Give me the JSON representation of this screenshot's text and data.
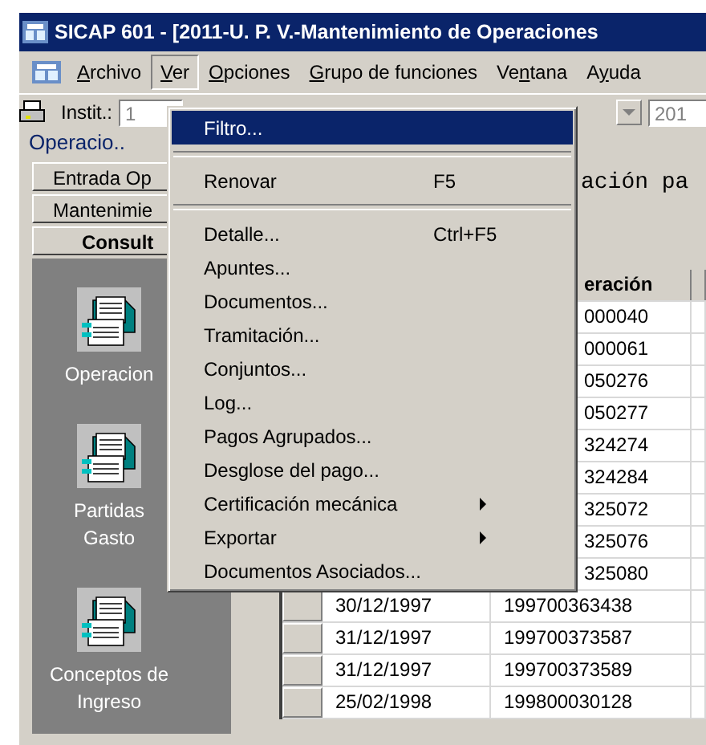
{
  "window": {
    "title": "SICAP 601 - [2011-U. P. V.-Mantenimiento de Operaciones"
  },
  "menubar": [
    {
      "key": "A",
      "post": "rchivo",
      "selected": false
    },
    {
      "key": "V",
      "post": "er",
      "selected": true
    },
    {
      "key": "O",
      "post": "pciones",
      "selected": false
    },
    {
      "key": "G",
      "post": "rupo de funciones",
      "selected": false
    },
    {
      "pre": "Ve",
      "key": "n",
      "post": "tana",
      "selected": false
    },
    {
      "pre": "A",
      "key": "y",
      "post": "uda",
      "selected": false
    }
  ],
  "toolbar": {
    "label": "Instit.:",
    "field_value": "1",
    "year_value": "201"
  },
  "sidebar": {
    "title": "Operacio..",
    "tabs": [
      {
        "label": "Entrada Op",
        "selected": false
      },
      {
        "label": "Mantenimie",
        "selected": false
      },
      {
        "label": "Consult",
        "selected": true
      }
    ],
    "items": [
      {
        "lines": [
          "Operacion"
        ]
      },
      {
        "lines": [
          "Partidas",
          "Gasto"
        ]
      },
      {
        "lines": [
          "Conceptos de",
          "Ingreso"
        ]
      }
    ]
  },
  "heading": "ación pa",
  "table": {
    "columns": [
      "eración"
    ],
    "rows": [
      {
        "number": "000040"
      },
      {
        "number": "000061"
      },
      {
        "number": "050276"
      },
      {
        "number": "050277"
      },
      {
        "number": "324274"
      },
      {
        "number": "324284"
      },
      {
        "number": "325072"
      },
      {
        "number": "325076"
      },
      {
        "number": "325080"
      },
      {
        "date": "30/12/1997",
        "number": "199700363438"
      },
      {
        "date": "31/12/1997",
        "number": "199700373587"
      },
      {
        "date": "31/12/1997",
        "number": "199700373589"
      },
      {
        "date": "25/02/1998",
        "number": "199800030128"
      }
    ]
  },
  "menu": [
    {
      "kind": "item",
      "label": "Filtro...",
      "selected": true
    },
    {
      "kind": "separator"
    },
    {
      "kind": "item",
      "label": "Renovar",
      "shortcut": "F5",
      "selected": false
    },
    {
      "kind": "separator"
    },
    {
      "kind": "item",
      "label": "Detalle...",
      "shortcut": "Ctrl+F5",
      "selected": false
    },
    {
      "kind": "item",
      "label": "Apuntes...",
      "selected": false
    },
    {
      "kind": "item",
      "label": "Documentos...",
      "selected": false
    },
    {
      "kind": "item",
      "label": "Tramitación...",
      "selected": false
    },
    {
      "kind": "item",
      "label": "Conjuntos...",
      "selected": false
    },
    {
      "kind": "item",
      "label": "Log...",
      "selected": false
    },
    {
      "kind": "item",
      "label": "Pagos Agrupados...",
      "selected": false
    },
    {
      "kind": "item",
      "label": "Desglose del pago...",
      "selected": false
    },
    {
      "kind": "item",
      "label": "Certificación mecánica",
      "submenu": true,
      "selected": false
    },
    {
      "kind": "item",
      "label": "Exportar",
      "submenu": true,
      "selected": false
    },
    {
      "kind": "item",
      "label": "Documentos Asociados...",
      "selected": false
    }
  ]
}
